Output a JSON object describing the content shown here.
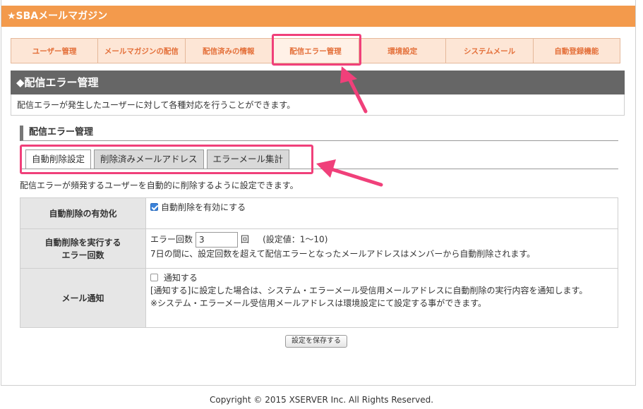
{
  "app": {
    "title": "★SBAメールマガジン"
  },
  "nav": {
    "items": [
      "ユーザー管理",
      "メールマガジンの配信",
      "配信済みの情報",
      "配信エラー管理",
      "環境設定",
      "システムメール",
      "自動登録機能"
    ],
    "active_index": 3
  },
  "section": {
    "title": "◆配信エラー管理",
    "description": "配信エラーが発生したユーザーに対して各種対応を行うことができます。"
  },
  "subsection": {
    "title": "配信エラー管理"
  },
  "tabs": {
    "items": [
      "自動削除設定",
      "削除済みメールアドレス",
      "エラーメール集計"
    ],
    "active_index": 0
  },
  "panel": {
    "description": "配信エラーが頻発するユーザーを自動的に削除するように設定できます。",
    "rows": {
      "enable": {
        "label": "自動削除の有効化",
        "checkbox_label": "自動削除を有効にする",
        "checked": true
      },
      "count": {
        "label_line1": "自動削除を実行する",
        "label_line2": "エラー回数",
        "prefix": "エラー回数",
        "value": "3",
        "unit": "回",
        "range": "(設定値：1〜10)",
        "note": "7日の間に、設定回数を超えて配信エラーとなったメールアドレスはメンバーから自動削除されます。"
      },
      "notify": {
        "label": "メール通知",
        "checkbox_label": "通知する",
        "checked": false,
        "note1": "[通知する]に設定した場合は、システム・エラーメール受信用メールアドレスに自動削除の実行内容を通知します。",
        "note2": "※システム・エラーメール受信用メールアドレスは環境設定にて設定する事ができます。"
      }
    },
    "save_label": "設定を保存する"
  },
  "footer": {
    "copyright": "Copyright © 2015 XSERVER Inc. All Rights Reserved."
  },
  "colors": {
    "brand": "#f39a4c",
    "nav_text": "#e4703a",
    "highlight": "#f0407a",
    "section_head": "#666666"
  }
}
